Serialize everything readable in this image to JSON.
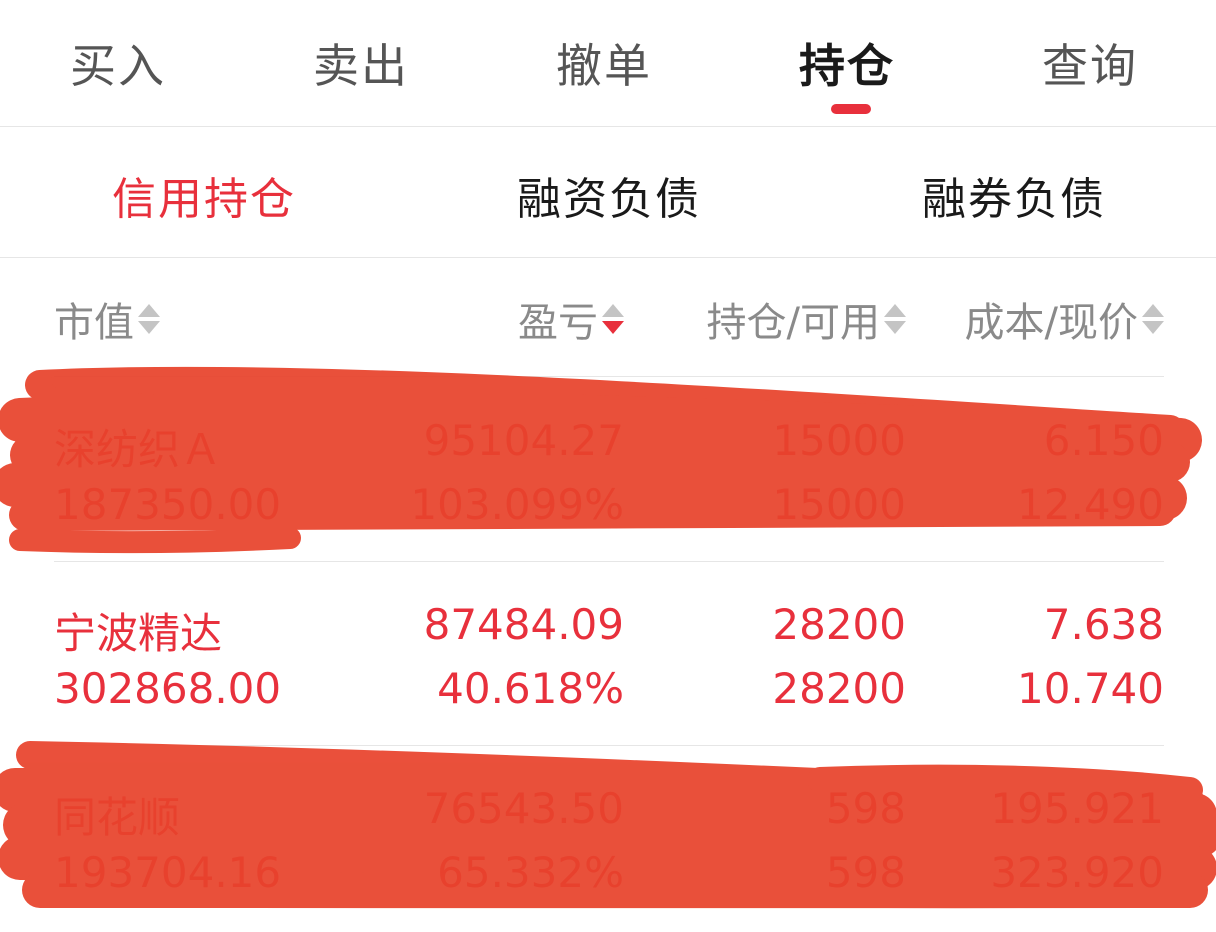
{
  "tabs": [
    {
      "label": "买入",
      "active": false
    },
    {
      "label": "卖出",
      "active": false
    },
    {
      "label": "撤单",
      "active": false
    },
    {
      "label": "持仓",
      "active": true
    },
    {
      "label": "查询",
      "active": false
    }
  ],
  "subtabs": [
    {
      "label": "信用持仓",
      "active": true
    },
    {
      "label": "融资负债",
      "active": false
    },
    {
      "label": "融券负债",
      "active": false
    }
  ],
  "columns": {
    "market_value": "市值",
    "pnl": "盈亏",
    "position_available": "持仓/可用",
    "cost_price": "成本/现价",
    "active_sort": "pnl-descending"
  },
  "positions": [
    {
      "name": "深纺织Ａ",
      "market_value": "187350.00",
      "pnl": "95104.27",
      "pnl_pct": "103.099%",
      "position": "15000",
      "available": "15000",
      "cost": "6.150",
      "price": "12.490",
      "redacted": true
    },
    {
      "name": "宁波精达",
      "market_value": "302868.00",
      "pnl": "87484.09",
      "pnl_pct": "40.618%",
      "position": "28200",
      "available": "28200",
      "cost": "7.638",
      "price": "10.740",
      "redacted": false
    },
    {
      "name": "同花顺",
      "market_value": "193704.16",
      "pnl": "76543.50",
      "pnl_pct": "65.332%",
      "position": "598",
      "available": "598",
      "cost": "195.921",
      "price": "323.920",
      "redacted": true
    }
  ],
  "colors": {
    "accent": "#e8303c",
    "scribble": "#e8432c",
    "header_text": "#8a8a8a",
    "divider": "#e6e6e6"
  }
}
